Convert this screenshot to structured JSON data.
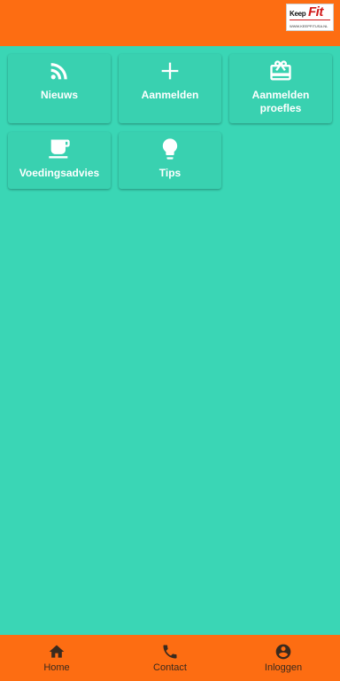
{
  "header": {
    "logo": {
      "text_keep": "Keep",
      "text_fit": "Fit",
      "text_url": "WWW.KEEPFITUSA.NL"
    }
  },
  "tiles": [
    {
      "label": "Nieuws",
      "icon": "rss-icon"
    },
    {
      "label": "Aanmelden",
      "icon": "plus-icon"
    },
    {
      "label": "Aanmelden proefles",
      "icon": "gift-icon"
    },
    {
      "label": "Voedingsadvies",
      "icon": "coffee-cup-icon"
    },
    {
      "label": "Tips",
      "icon": "lightbulb-icon"
    }
  ],
  "bottom_nav": {
    "items": [
      {
        "label": "Home",
        "icon": "home-icon"
      },
      {
        "label": "Contact",
        "icon": "phone-icon"
      },
      {
        "label": "Inloggen",
        "icon": "account-circle-icon"
      }
    ]
  },
  "colors": {
    "primary": "#fd6d12",
    "background": "#3ad6b5"
  }
}
